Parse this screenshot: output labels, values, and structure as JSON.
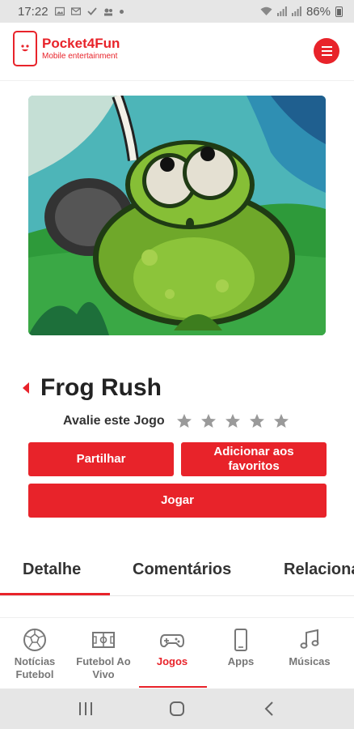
{
  "status_bar": {
    "time": "17:22",
    "battery": "86%",
    "icons": [
      "image-icon",
      "mail-icon",
      "check-icon",
      "cast-icon",
      "dot-icon",
      "wifi-icon",
      "signal-icon",
      "signal-icon",
      "battery-icon"
    ]
  },
  "header": {
    "logo_name": "Pocket4Fun",
    "logo_tagline": "Mobile entertainment",
    "menu_icon": "hamburger-icon"
  },
  "game": {
    "title": "Frog Rush",
    "rating_label": "Avalie este Jogo",
    "rating_value": 0,
    "rating_max": 5
  },
  "actions": {
    "share": "Partilhar",
    "favorite": "Adicionar aos favoritos",
    "play": "Jogar"
  },
  "tabs": [
    {
      "label": "Detalhe",
      "active": true
    },
    {
      "label": "Comentários",
      "active": false
    },
    {
      "label": "Relacionados",
      "active": false
    }
  ],
  "bottom_nav": [
    {
      "label": "Notícias Futebol",
      "icon": "soccer-ball-icon",
      "active": false
    },
    {
      "label": "Futebol Ao Vivo",
      "icon": "soccer-field-icon",
      "active": false
    },
    {
      "label": "Jogos",
      "icon": "gamepad-icon",
      "active": true
    },
    {
      "label": "Apps",
      "icon": "smartphone-icon",
      "active": false
    },
    {
      "label": "Músicas",
      "icon": "music-note-icon",
      "active": false
    }
  ],
  "system_nav": [
    "recent-apps-icon",
    "home-icon",
    "back-icon"
  ],
  "colors": {
    "accent": "#e8232a",
    "text_dark": "#222222",
    "nav_inactive": "#777777",
    "star_inactive": "#9a9a9a",
    "system_bar": "#e6e6e6"
  }
}
